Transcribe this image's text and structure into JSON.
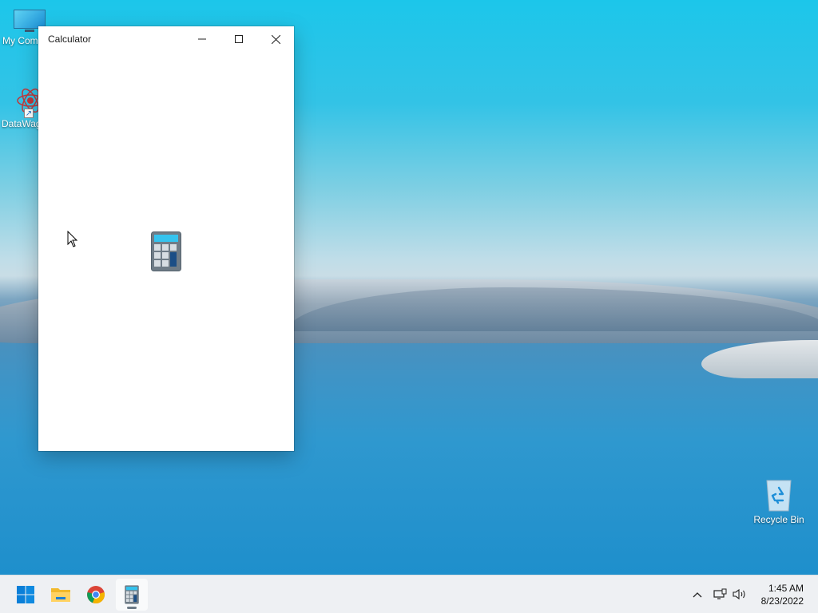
{
  "desktop": {
    "icons": [
      {
        "label": "My Com",
        "icon": "monitor-icon"
      },
      {
        "label": "DataWag",
        "icon": "datawagon-icon"
      },
      {
        "label": "Recycle Bin",
        "icon": "recycle-bin-icon"
      }
    ]
  },
  "window": {
    "title": "Calculator",
    "controls": {
      "minimize": "minimize-icon",
      "maximize": "maximize-icon",
      "close": "close-icon"
    },
    "splash_icon": "calculator-icon"
  },
  "taskbar": {
    "apps": [
      {
        "name": "Start",
        "icon": "windows-start-icon"
      },
      {
        "name": "File Explorer",
        "icon": "folder-icon"
      },
      {
        "name": "Google Chrome",
        "icon": "chrome-icon"
      },
      {
        "name": "Calculator",
        "icon": "calculator-icon",
        "active": true
      }
    ],
    "tray": {
      "icons": [
        "chevron-up-icon",
        "network-icon",
        "volume-icon"
      ],
      "time": "1:45 AM",
      "date": "8/23/2022"
    }
  },
  "colors": {
    "accent": "#0078d4",
    "taskbar_bg": "#eef0f3",
    "window_bg": "#ffffff"
  }
}
